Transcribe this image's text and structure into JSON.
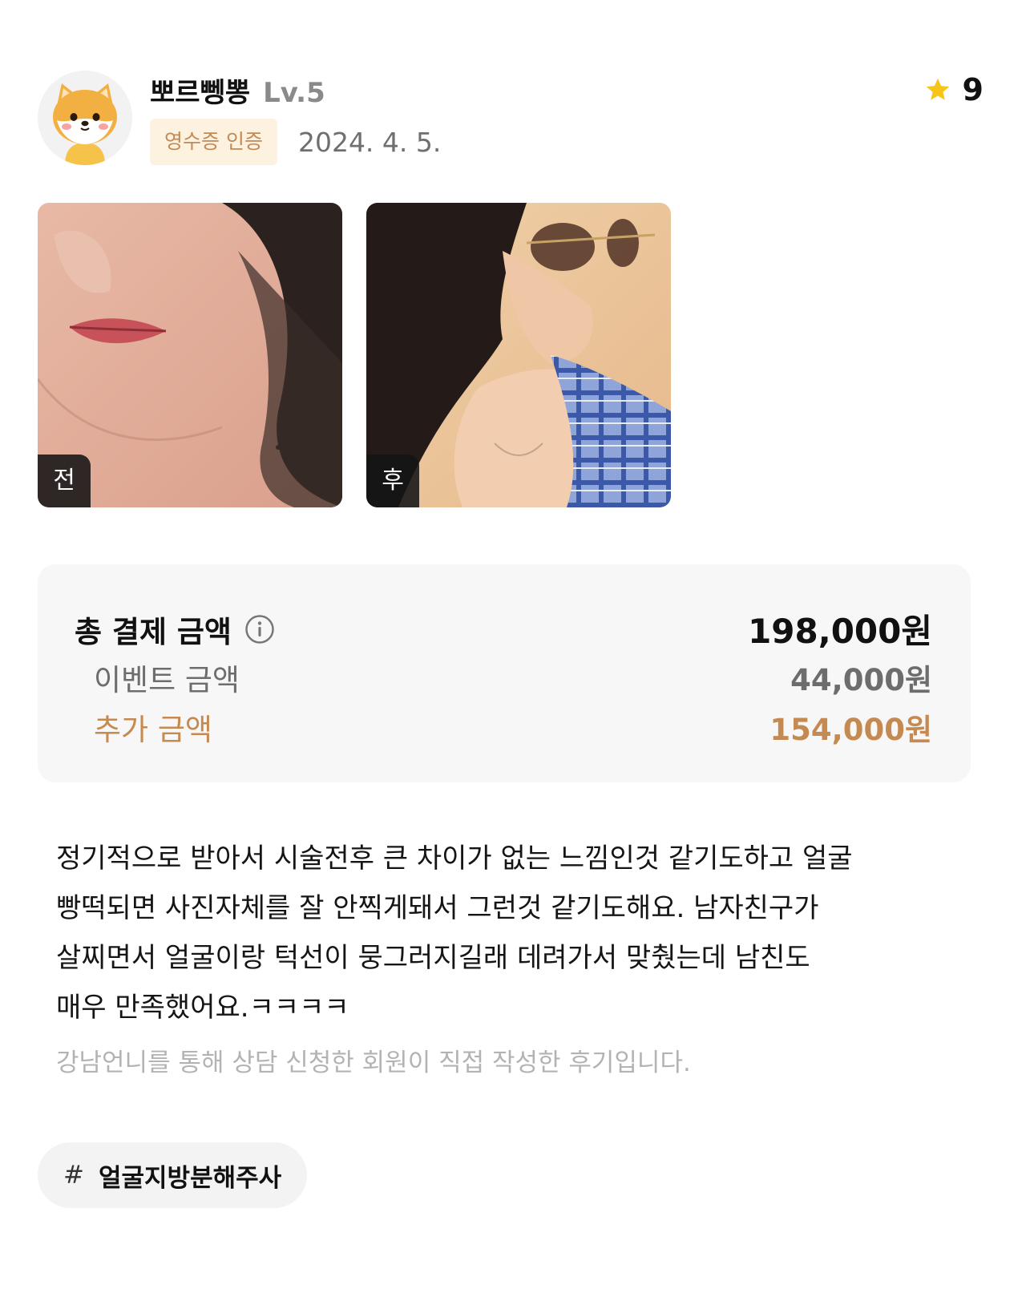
{
  "user": {
    "nickname": "뽀르뼁뽕",
    "level": "Lv.5",
    "badge": "영수증 인증",
    "date": "2024. 4. 5.",
    "rating": "9"
  },
  "photos": [
    {
      "tag": "전"
    },
    {
      "tag": "후"
    }
  ],
  "price": {
    "total_label": "총 결제 금액",
    "total_value": "198,000원",
    "event_label": "이벤트 금액",
    "event_value": "44,000원",
    "extra_label": "추가 금액",
    "extra_value": "154,000원"
  },
  "review": {
    "text_lines": [
      "정기적으로 받아서 시술전후 큰 차이가 없는 느낌인것 같기도하고 얼굴",
      "빵떡되면 사진자체를 잘 안찍게돼서 그런것 같기도해요. 남자친구가",
      "살찌면서 얼굴이랑 턱선이 뭉그러지길래 데려가서 맞췄는데 남친도",
      "매우 만족했어요.ㅋㅋㅋㅋ"
    ],
    "note": "강남언니를 통해 상담 신청한 회원이 직접 작성한 후기입니다."
  },
  "hashtag": {
    "symbol": "#",
    "label": "얼굴지방분해주사"
  },
  "colors": {
    "accent": "#c58a52",
    "badge_bg": "#fdf1df",
    "star": "#f5c518"
  },
  "icons": [
    "shiba-avatar-icon",
    "star-icon",
    "info-icon"
  ]
}
